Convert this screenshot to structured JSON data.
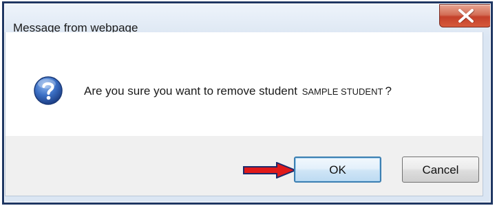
{
  "window": {
    "title": "Message from webpage",
    "close_symbol": "✕"
  },
  "message": {
    "text": "Are you sure you want to remove student",
    "student_name": "SAMPLE STUDENT",
    "end_mark": "?"
  },
  "buttons": {
    "ok_label": "OK",
    "cancel_label": "Cancel"
  },
  "icons": {
    "message_icon": "question-icon",
    "close_icon": "close-icon",
    "pointer": "red-arrow-icon"
  },
  "colors": {
    "close_button": "#c4402a",
    "ok_border": "#3c7fb1",
    "arrow": "#e11a1a",
    "question_icon": "#2a5fb0"
  }
}
